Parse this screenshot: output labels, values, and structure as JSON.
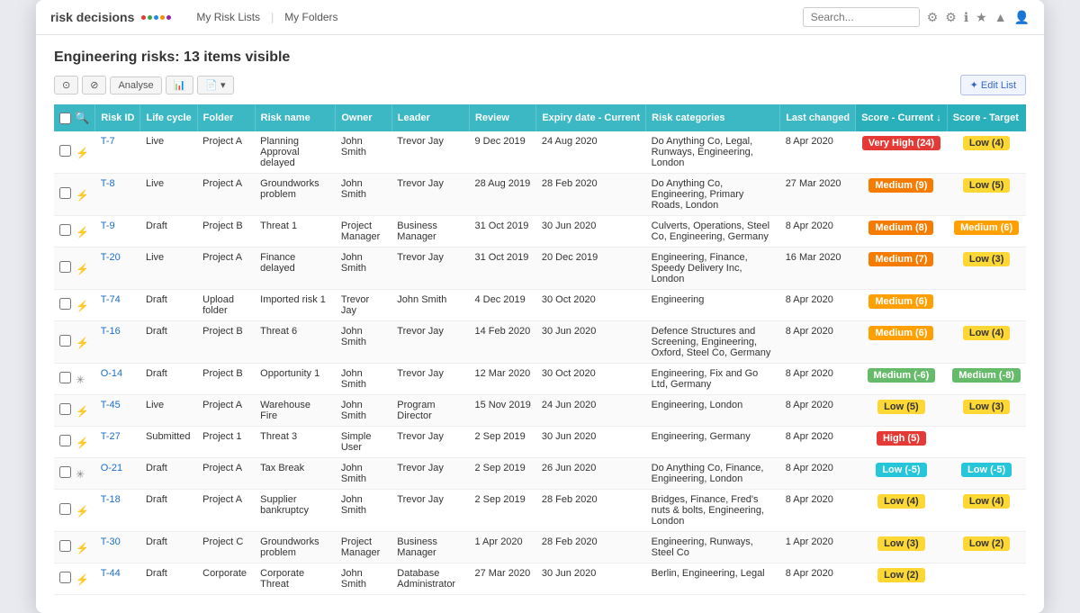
{
  "app": {
    "logo": "risk decisions",
    "nav_links": [
      "My Risk Lists",
      "My Folders"
    ]
  },
  "header": {
    "search_placeholder": "Search...",
    "icons": [
      "⚙",
      "⚙",
      "ℹ",
      "★",
      "▲",
      "👤"
    ]
  },
  "page": {
    "title": "Engineering risks:  13 items visible"
  },
  "toolbar": {
    "buttons": [
      "⊙",
      "⊘",
      "Analyse",
      "📊",
      "📄"
    ],
    "edit_list": "✦ Edit List"
  },
  "table": {
    "columns": [
      "",
      "",
      "Risk ID",
      "Life cycle",
      "Folder",
      "Risk name",
      "Owner",
      "Leader",
      "Review",
      "Expiry date - Current",
      "Risk categories",
      "Last changed",
      "Score - Current ↓",
      "Score - Target"
    ],
    "rows": [
      {
        "id": "T-7",
        "lifecycle": "Live",
        "folder": "Project A",
        "name": "Planning Approval delayed",
        "owner": "John Smith",
        "leader": "Trevor Jay",
        "review": "9 Dec 2019",
        "expiry": "24 Aug 2020",
        "categories": "Do Anything Co, Legal, Runways, Engineering, London",
        "last_changed": "8 Apr 2020",
        "score_current": "Very High (24)",
        "score_current_class": "score-very-high",
        "score_target": "Low (4)",
        "score_target_class": "score-low-yellow",
        "icon": "⚡",
        "is_opportunity": false
      },
      {
        "id": "T-8",
        "lifecycle": "Live",
        "folder": "Project A",
        "name": "Groundworks problem",
        "owner": "John Smith",
        "leader": "Trevor Jay",
        "review": "28 Aug 2019",
        "expiry": "28 Feb 2020",
        "categories": "Do Anything Co, Engineering, Primary Roads, London",
        "last_changed": "27 Mar 2020",
        "score_current": "Medium (9)",
        "score_current_class": "score-medium-orange",
        "score_target": "Low (5)",
        "score_target_class": "score-low-yellow",
        "icon": "⚡",
        "is_opportunity": false
      },
      {
        "id": "T-9",
        "lifecycle": "Draft",
        "folder": "Project B",
        "name": "Threat 1",
        "owner": "Project Manager",
        "leader": "Business Manager",
        "review": "31 Oct 2019",
        "expiry": "30 Jun 2020",
        "categories": "Culverts, Operations, Steel Co, Engineering, Germany",
        "last_changed": "8 Apr 2020",
        "score_current": "Medium (8)",
        "score_current_class": "score-medium-orange",
        "score_target": "Medium (6)",
        "score_target_class": "score-medium-amber",
        "icon": "⚡",
        "is_opportunity": false
      },
      {
        "id": "T-20",
        "lifecycle": "Live",
        "folder": "Project A",
        "name": "Finance delayed",
        "owner": "John Smith",
        "leader": "Trevor Jay",
        "review": "31 Oct 2019",
        "expiry": "20 Dec 2019",
        "categories": "Engineering, Finance, Speedy Delivery Inc, London",
        "last_changed": "16 Mar 2020",
        "score_current": "Medium (7)",
        "score_current_class": "score-medium-orange",
        "score_target": "Low (3)",
        "score_target_class": "score-low-yellow",
        "icon": "⚡",
        "is_opportunity": false
      },
      {
        "id": "T-74",
        "lifecycle": "Draft",
        "folder": "Upload folder",
        "name": "Imported risk 1",
        "owner": "Trevor Jay",
        "leader": "John Smith",
        "review": "4 Dec 2019",
        "expiry": "30 Oct 2020",
        "categories": "Engineering",
        "last_changed": "8 Apr 2020",
        "score_current": "Medium (6)",
        "score_current_class": "score-medium-amber",
        "score_target": "",
        "score_target_class": "",
        "icon": "⚡",
        "is_opportunity": false
      },
      {
        "id": "T-16",
        "lifecycle": "Draft",
        "folder": "Project B",
        "name": "Threat 6",
        "owner": "John Smith",
        "leader": "Trevor Jay",
        "review": "14 Feb 2020",
        "expiry": "30 Jun 2020",
        "categories": "Defence Structures and Screening, Engineering, Oxford, Steel Co, Germany",
        "last_changed": "8 Apr 2020",
        "score_current": "Medium (6)",
        "score_current_class": "score-medium-amber",
        "score_target": "Low (4)",
        "score_target_class": "score-low-yellow",
        "icon": "⚡",
        "is_opportunity": false
      },
      {
        "id": "O-14",
        "lifecycle": "Draft",
        "folder": "Project B",
        "name": "Opportunity 1",
        "owner": "John Smith",
        "leader": "Trevor Jay",
        "review": "12 Mar 2020",
        "expiry": "30 Oct 2020",
        "categories": "Engineering, Fix and Go Ltd, Germany",
        "last_changed": "8 Apr 2020",
        "score_current": "Medium (-6)",
        "score_current_class": "score-medium-neg",
        "score_target": "Medium (-8)",
        "score_target_class": "score-medium-neg",
        "icon": "✳",
        "is_opportunity": true
      },
      {
        "id": "T-45",
        "lifecycle": "Live",
        "folder": "Project A",
        "name": "Warehouse Fire",
        "owner": "John Smith",
        "leader": "Program Director",
        "review": "15 Nov 2019",
        "expiry": "24 Jun 2020",
        "categories": "Engineering, London",
        "last_changed": "8 Apr 2020",
        "score_current": "Low (5)",
        "score_current_class": "score-low-yellow",
        "score_target": "Low (3)",
        "score_target_class": "score-low-yellow",
        "icon": "⚡",
        "is_opportunity": false
      },
      {
        "id": "T-27",
        "lifecycle": "Submitted",
        "folder": "Project 1",
        "name": "Threat 3",
        "owner": "Simple User",
        "leader": "Trevor Jay",
        "review": "2 Sep 2019",
        "expiry": "30 Jun 2020",
        "categories": "Engineering, Germany",
        "last_changed": "8 Apr 2020",
        "score_current": "High (5)",
        "score_current_class": "score-high",
        "score_target": "",
        "score_target_class": "",
        "icon": "⚡",
        "is_opportunity": false
      },
      {
        "id": "O-21",
        "lifecycle": "Draft",
        "folder": "Project A",
        "name": "Tax Break",
        "owner": "John Smith",
        "leader": "Trevor Jay",
        "review": "2 Sep 2019",
        "expiry": "26 Jun 2020",
        "categories": "Do Anything Co, Finance, Engineering, London",
        "last_changed": "8 Apr 2020",
        "score_current": "Low (-5)",
        "score_current_class": "score-low-neg",
        "score_target": "Low (-5)",
        "score_target_class": "score-low-neg",
        "icon": "✳",
        "is_opportunity": true
      },
      {
        "id": "T-18",
        "lifecycle": "Draft",
        "folder": "Project A",
        "name": "Supplier bankruptcy",
        "owner": "John Smith",
        "leader": "Trevor Jay",
        "review": "2 Sep 2019",
        "expiry": "28 Feb 2020",
        "categories": "Bridges, Finance, Fred's nuts & bolts, Engineering, London",
        "last_changed": "8 Apr 2020",
        "score_current": "Low (4)",
        "score_current_class": "score-low-yellow",
        "score_target": "Low (4)",
        "score_target_class": "score-low-yellow",
        "icon": "⚡",
        "is_opportunity": false
      },
      {
        "id": "T-30",
        "lifecycle": "Draft",
        "folder": "Project C",
        "name": "Groundworks problem",
        "owner": "Project Manager",
        "leader": "Business Manager",
        "review": "1 Apr 2020",
        "expiry": "28 Feb 2020",
        "categories": "Engineering, Runways, Steel Co",
        "last_changed": "1 Apr 2020",
        "score_current": "Low (3)",
        "score_current_class": "score-low-yellow",
        "score_target": "Low (2)",
        "score_target_class": "score-low-yellow",
        "icon": "⚡",
        "is_opportunity": false
      },
      {
        "id": "T-44",
        "lifecycle": "Draft",
        "folder": "Corporate",
        "name": "Corporate Threat",
        "owner": "John Smith",
        "leader": "Database Administrator",
        "review": "27 Mar 2020",
        "expiry": "30 Jun 2020",
        "categories": "Berlin, Engineering, Legal",
        "last_changed": "8 Apr 2020",
        "score_current": "Low (2)",
        "score_current_class": "score-low-yellow",
        "score_target": "",
        "score_target_class": "",
        "icon": "⚡",
        "is_opportunity": false
      }
    ]
  }
}
